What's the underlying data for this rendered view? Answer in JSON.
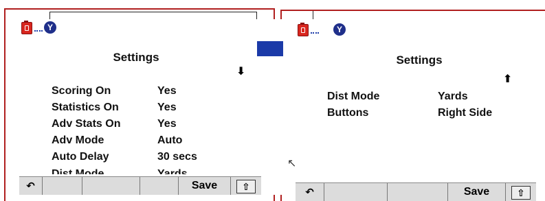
{
  "left_screen": {
    "title": "Settings",
    "scroll_arrow": "⬇",
    "rows": [
      {
        "label": "Scoring On",
        "value": "Yes"
      },
      {
        "label": "Statistics On",
        "value": "Yes"
      },
      {
        "label": "Adv Stats On",
        "value": "Yes"
      },
      {
        "label": "Adv Mode",
        "value": "Auto"
      },
      {
        "label": "Auto Delay",
        "value": "30 secs"
      },
      {
        "label": "Dist Mode",
        "value": "Yards"
      }
    ],
    "softkeys": {
      "back": "↶",
      "save": "Save",
      "shift": "⇧"
    },
    "status_icon_letter": "Y"
  },
  "right_screen": {
    "title": "Settings",
    "scroll_arrow": "⬆",
    "rows": [
      {
        "label": "Dist Mode",
        "value": "Yards"
      },
      {
        "label": "Buttons",
        "value": "Right Side"
      }
    ],
    "softkeys": {
      "back": "↶",
      "save": "Save",
      "shift": "⇧"
    },
    "status_icon_letter": "Y"
  },
  "icons": {
    "battery": "battery-icon",
    "signal": "signal-dots-icon",
    "profile": "y-circle-icon",
    "back": "back-arrow-icon",
    "shift": "shift-icon",
    "cursor": "mouse-cursor-icon"
  },
  "colors": {
    "battery_red": "#d8261e",
    "profile_blue": "#1f2f8a",
    "frame_red": "#b01e1e",
    "softkey_gray": "#dcdcdc"
  }
}
